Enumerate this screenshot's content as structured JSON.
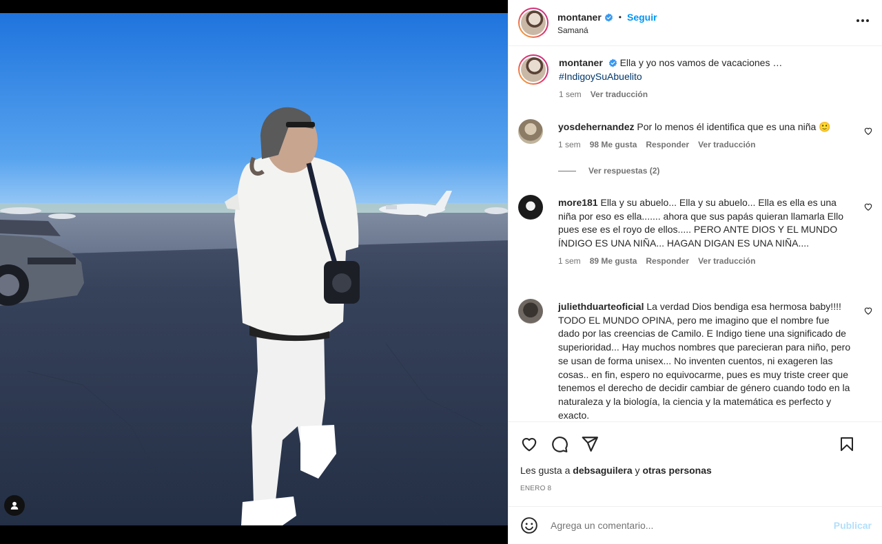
{
  "post": {
    "author": {
      "username": "montaner",
      "verified": true,
      "location": "Samaná"
    },
    "follow_label": "Seguir",
    "separator": "•",
    "caption": {
      "username": "montaner",
      "text": "Ella y yo nos vamos de vacaciones …",
      "hashtag": "#IndigoySuAbuelito",
      "time": "1 sem",
      "translate_label": "Ver traducción"
    },
    "comments": [
      {
        "username": "yosdehernandez",
        "text": "Por lo menos él identifica que es una niña 🙂",
        "time": "1 sem",
        "likes": "98 Me gusta",
        "reply_label": "Responder",
        "translate_label": "Ver traducción",
        "view_replies": "Ver respuestas (2)"
      },
      {
        "username": "more181",
        "text": "Ella y su abuelo... Ella y su abuelo... Ella es ella es una niña por eso es ella....... ahora que sus papás quieran llamarla Ello pues ese es el royo de ellos..... PERO ANTE DIOS Y EL MUNDO ÍNDIGO ES UNA NIÑA... HAGAN DIGAN ES UNA NIÑA....",
        "time": "1 sem",
        "likes": "89 Me gusta",
        "reply_label": "Responder",
        "translate_label": "Ver traducción"
      },
      {
        "username": "juliethduarteoficial",
        "text": "La verdad Dios bendiga esa hermosa baby!!!! TODO EL MUNDO OPINA, pero me imagino que el nombre fue dado por las creencias de Camilo. E Indigo tiene una significado de superioridad... Hay muchos nombres que parecieran para niño, pero se usan de forma unisex... No inventen cuentos, ni exageren las cosas.. en fin, espero no equivocarme, pues es muy triste creer que tenemos el derecho de decidir cambiar de género cuando todo en la naturaleza y la biología, la ciencia y la matemática es perfecto y exacto."
      }
    ],
    "likes_prefix": "Les gusta a",
    "likes_user": "debsaguilera",
    "likes_and": "y",
    "likes_others": "otras personas",
    "date": "ENERO 8",
    "comment_placeholder": "Agrega un comentario...",
    "publish_label": "Publicar"
  },
  "icons": {
    "more": "more-horizontal-icon",
    "like": "heart-icon",
    "comment": "comment-icon",
    "share": "paper-plane-icon",
    "save": "bookmark-icon",
    "emoji": "smiley-icon",
    "tag": "user-tag-icon"
  },
  "colors": {
    "accent": "#0095f6",
    "publish_disabled": "#b2dffc",
    "hashtag": "#00376b",
    "secondary_text": "#737373",
    "verified": "#3897f0"
  }
}
